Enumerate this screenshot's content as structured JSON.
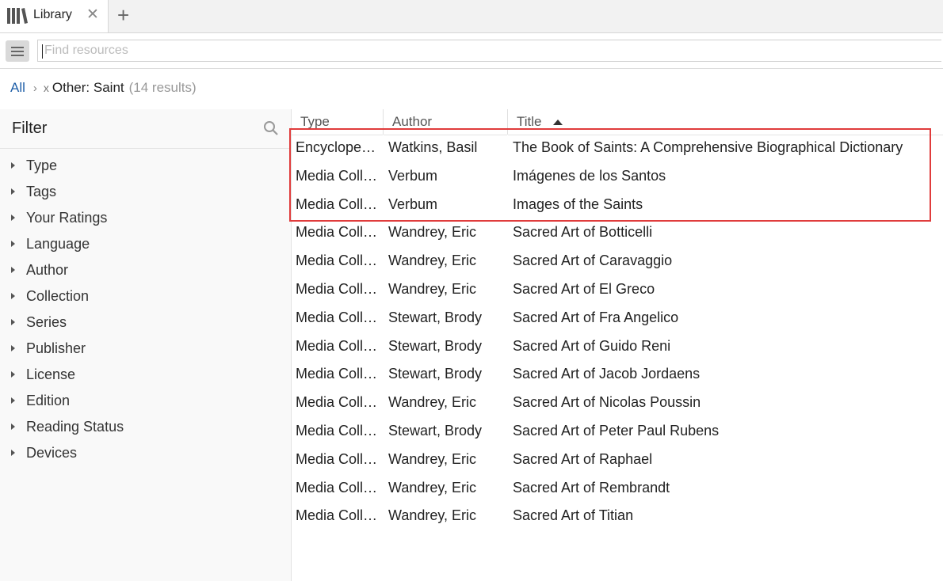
{
  "tab": {
    "label": "Library",
    "close_glyph": "✕",
    "add_glyph": "+",
    "icon": "library-books-icon"
  },
  "search": {
    "placeholder": "Find resources",
    "value": ""
  },
  "breadcrumb": {
    "all": "All",
    "separator": "›",
    "remove_glyph": "x",
    "filter": "Other: Saint",
    "count": "(14 results)"
  },
  "filter": {
    "title": "Filter",
    "items": [
      {
        "label": "Type"
      },
      {
        "label": "Tags"
      },
      {
        "label": "Your Ratings"
      },
      {
        "label": "Language"
      },
      {
        "label": "Author"
      },
      {
        "label": "Collection"
      },
      {
        "label": "Series"
      },
      {
        "label": "Publisher"
      },
      {
        "label": "License"
      },
      {
        "label": "Edition"
      },
      {
        "label": "Reading Status"
      },
      {
        "label": "Devices"
      }
    ]
  },
  "table": {
    "columns": [
      "Type",
      "Author",
      "Title"
    ],
    "sorted_column": "Title",
    "sort_direction": "ascending",
    "rows": [
      {
        "type": "Encyclope…",
        "author": "Watkins, Basil",
        "title": "The Book of Saints: A Comprehensive Biographical Dictionary"
      },
      {
        "type": "Media Coll…",
        "author": "Verbum",
        "title": "Imágenes de los Santos"
      },
      {
        "type": "Media Coll…",
        "author": "Verbum",
        "title": "Images of the Saints"
      },
      {
        "type": "Media Coll…",
        "author": "Wandrey, Eric",
        "title": "Sacred Art of Botticelli"
      },
      {
        "type": "Media Coll…",
        "author": "Wandrey, Eric",
        "title": "Sacred Art of Caravaggio"
      },
      {
        "type": "Media Coll…",
        "author": "Wandrey, Eric",
        "title": "Sacred Art of El Greco"
      },
      {
        "type": "Media Coll…",
        "author": "Stewart, Brody",
        "title": "Sacred Art of Fra Angelico"
      },
      {
        "type": "Media Coll…",
        "author": "Stewart, Brody",
        "title": "Sacred Art of Guido Reni"
      },
      {
        "type": "Media Coll…",
        "author": "Stewart, Brody",
        "title": "Sacred Art of Jacob Jordaens"
      },
      {
        "type": "Media Coll…",
        "author": "Wandrey, Eric",
        "title": "Sacred Art of Nicolas Poussin"
      },
      {
        "type": "Media Coll…",
        "author": "Stewart, Brody",
        "title": "Sacred Art of Peter Paul Rubens"
      },
      {
        "type": "Media Coll…",
        "author": "Wandrey, Eric",
        "title": "Sacred Art of Raphael"
      },
      {
        "type": "Media Coll…",
        "author": "Wandrey, Eric",
        "title": "Sacred Art of Rembrandt"
      },
      {
        "type": "Media Coll…",
        "author": "Wandrey, Eric",
        "title": "Sacred Art of Titian"
      }
    ]
  },
  "colors": {
    "link": "#1f5fa8",
    "highlight_border": "#e03c3c",
    "panel_bg": "#f9f9f9"
  }
}
